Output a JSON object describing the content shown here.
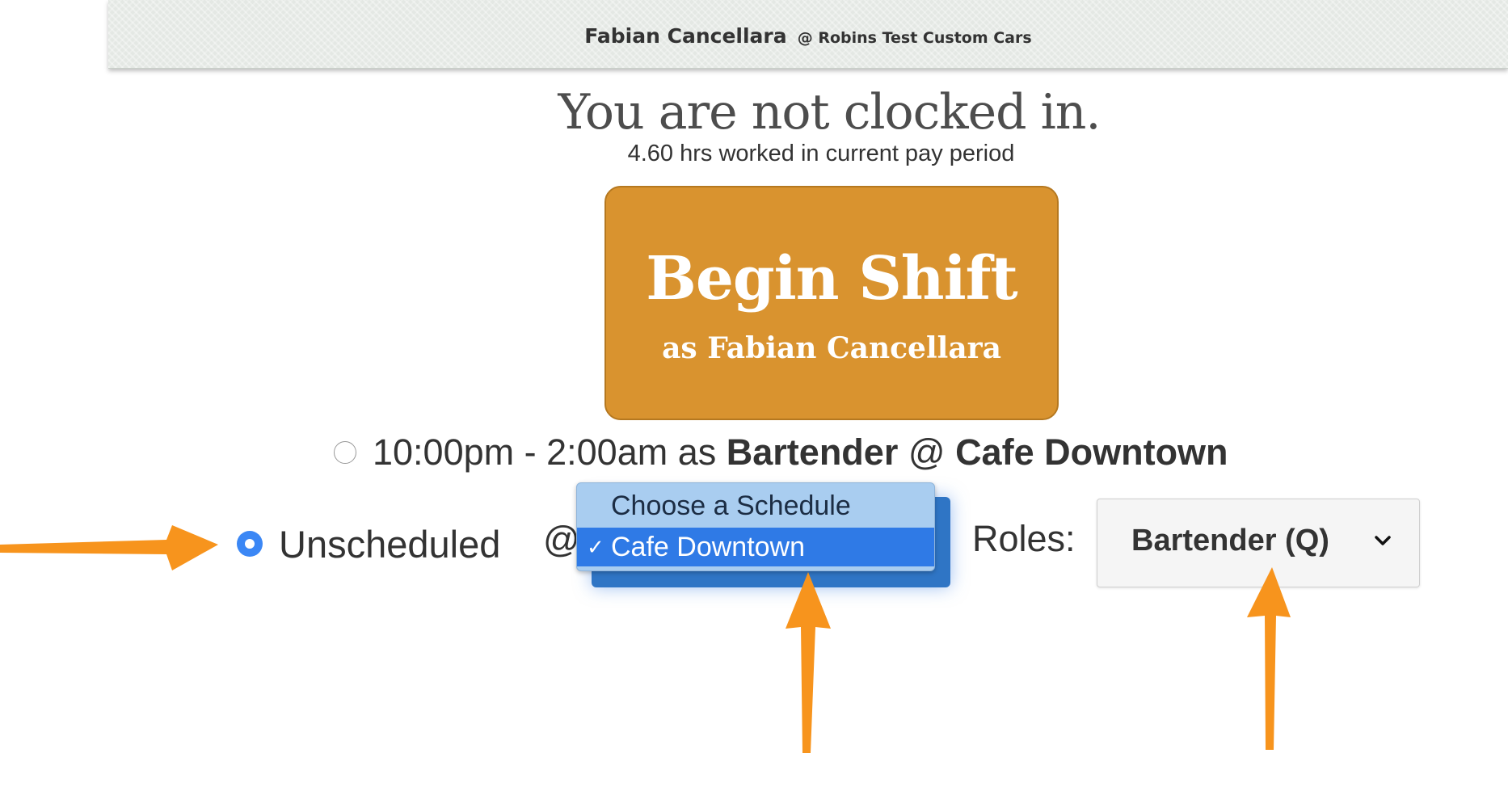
{
  "header": {
    "user_name": "Fabian Cancellara",
    "company": "@ Robins Test Custom Cars"
  },
  "status": {
    "title": "You are not clocked in.",
    "hours_text": "4.60 hrs worked in current pay period"
  },
  "begin_button": {
    "label": "Begin Shift",
    "sublabel": "as Fabian Cancellara",
    "color": "#d9932f"
  },
  "scheduled_shift": {
    "time": "10:00pm - 2:00am as",
    "role": "Bartender",
    "at": "@",
    "location": "Cafe Downtown",
    "selected": false
  },
  "unscheduled": {
    "label": "Unscheduled",
    "selected": true,
    "at": "@"
  },
  "schedule_dropdown": {
    "options": [
      "Choose a Schedule",
      "Cafe Downtown"
    ],
    "selected": "Cafe Downtown",
    "check": "✓"
  },
  "roles": {
    "label": "Roles:",
    "value": "Bartender (Q)",
    "icon": "chevron-down-icon"
  },
  "annotations": {
    "arrow_color": "#f7941d"
  }
}
